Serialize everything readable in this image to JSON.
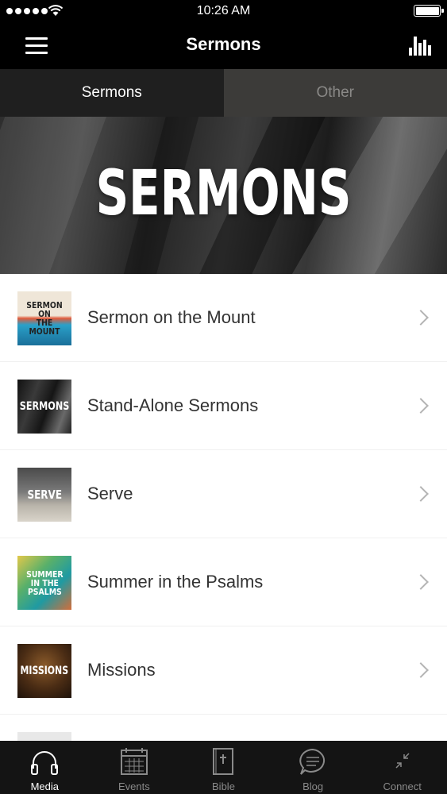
{
  "status_bar": {
    "time": "10:26 AM"
  },
  "nav": {
    "title": "Sermons"
  },
  "segments": [
    {
      "label": "Sermons",
      "active": true
    },
    {
      "label": "Other",
      "active": false
    }
  ],
  "hero": {
    "title": "SERMONS"
  },
  "items": [
    {
      "label": "Sermon on the Mount",
      "thumb_text": [
        "SERMON ON",
        "THE MOUNT"
      ]
    },
    {
      "label": "Stand-Alone Sermons",
      "thumb_text": [
        "SERMONS"
      ]
    },
    {
      "label": "Serve",
      "thumb_text": [
        "SERVE"
      ]
    },
    {
      "label": "Summer in the Psalms",
      "thumb_text": [
        "SUMMER",
        "IN THE",
        "PSALMS"
      ]
    },
    {
      "label": "Missions",
      "thumb_text": [
        "MISSIONS"
      ]
    }
  ],
  "tab_bar": [
    {
      "label": "Media",
      "icon": "headphones-icon",
      "active": true
    },
    {
      "label": "Events",
      "icon": "calendar-icon",
      "active": false
    },
    {
      "label": "Bible",
      "icon": "bible-icon",
      "active": false
    },
    {
      "label": "Blog",
      "icon": "chat-bubble-icon",
      "active": false
    },
    {
      "label": "Connect",
      "icon": "connect-arrows-icon",
      "active": false
    }
  ],
  "colors": {
    "nav_bg": "#000000",
    "segment_active": "#1f1f1f",
    "segment_inactive": "#3c3b39",
    "tab_bar_bg": "#141414"
  }
}
